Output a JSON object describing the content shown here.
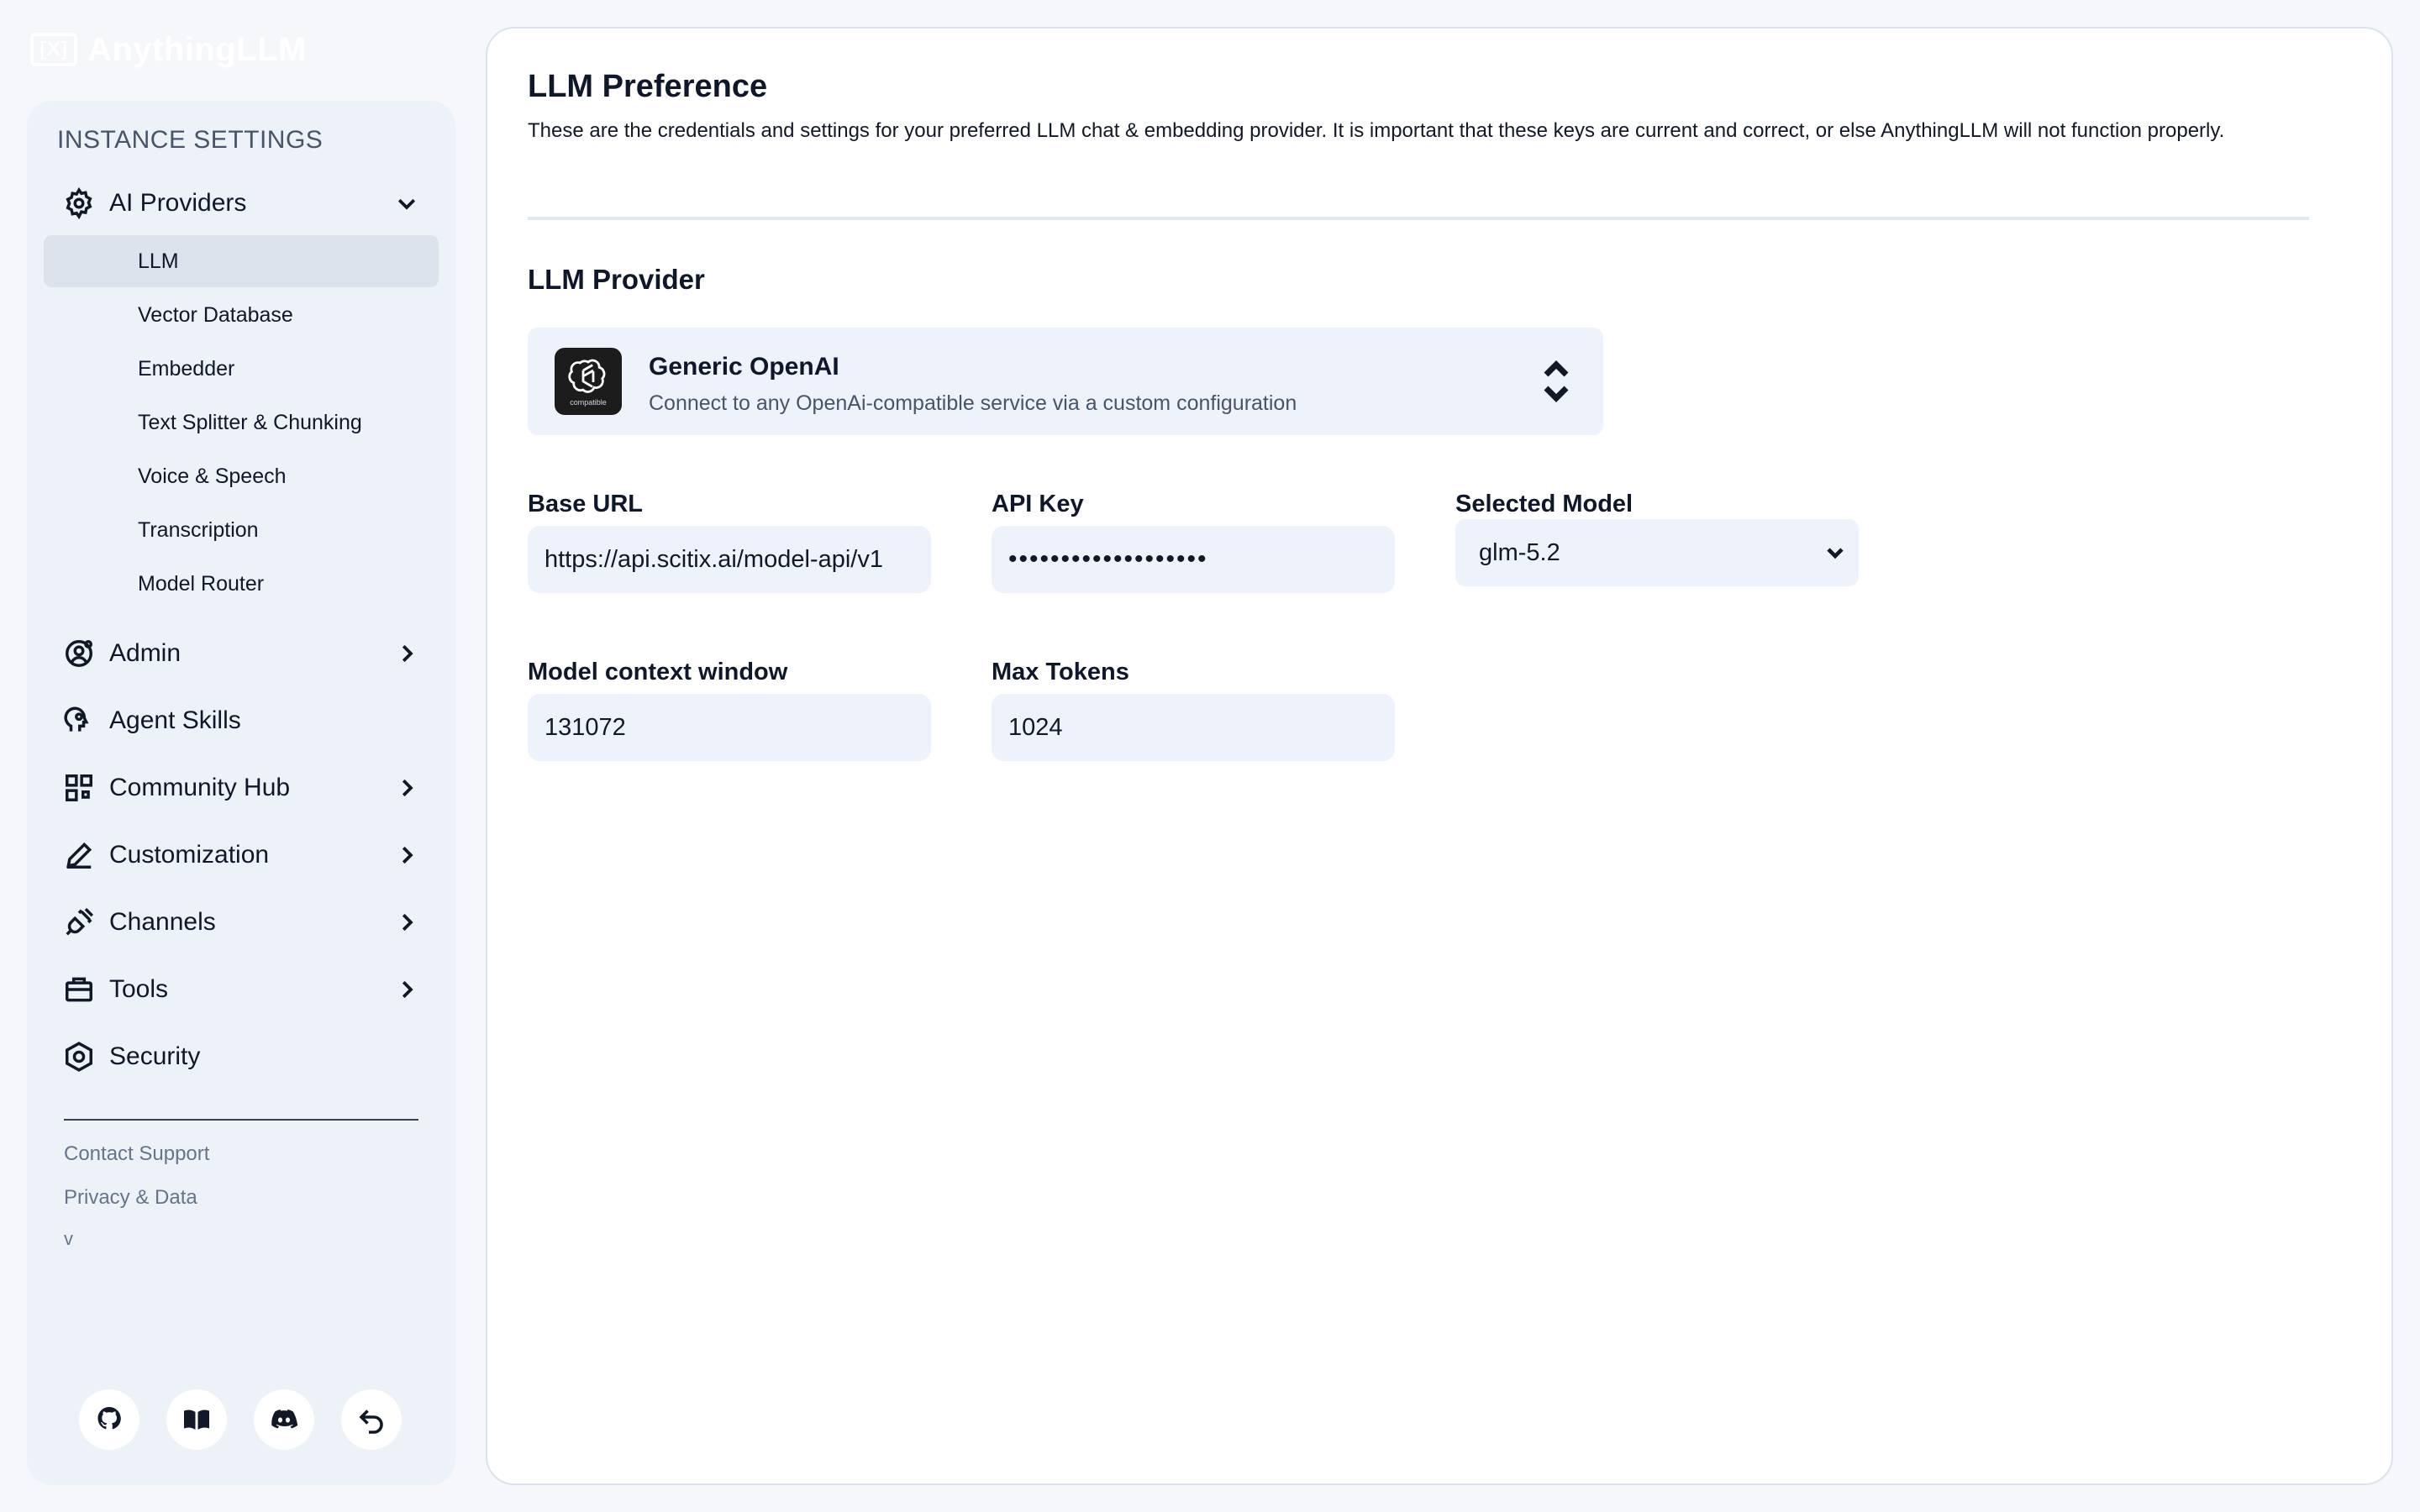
{
  "app": {
    "logo_text": "AnythingLLM",
    "logo_mark": "[X]"
  },
  "sidebar": {
    "header": "INSTANCE SETTINGS",
    "ai_providers": {
      "label": "AI Providers",
      "icon": "gear-icon",
      "expanded": true,
      "children": [
        {
          "label": "LLM",
          "active": true
        },
        {
          "label": "Vector Database",
          "active": false
        },
        {
          "label": "Embedder",
          "active": false
        },
        {
          "label": "Text Splitter & Chunking",
          "active": false
        },
        {
          "label": "Voice & Speech",
          "active": false
        },
        {
          "label": "Transcription",
          "active": false
        },
        {
          "label": "Model Router",
          "active": false
        }
      ]
    },
    "items": [
      {
        "label": "Admin",
        "icon": "user-gear-icon",
        "has_chevron": true
      },
      {
        "label": "Agent Skills",
        "icon": "brain-head-icon",
        "has_chevron": false
      },
      {
        "label": "Community Hub",
        "icon": "grid-squares-icon",
        "has_chevron": true
      },
      {
        "label": "Customization",
        "icon": "pencil-icon",
        "has_chevron": true
      },
      {
        "label": "Channels",
        "icon": "plug-icon",
        "has_chevron": true
      },
      {
        "label": "Tools",
        "icon": "toolbox-icon",
        "has_chevron": true
      },
      {
        "label": "Security",
        "icon": "shield-hexagon-icon",
        "has_chevron": false
      }
    ],
    "footer": {
      "contact_support": "Contact Support",
      "privacy_data": "Privacy & Data",
      "version": "v"
    },
    "bottom_icons": [
      "github-icon",
      "book-icon",
      "discord-icon",
      "undo-arrow-icon"
    ]
  },
  "main": {
    "title": "LLM Preference",
    "description": "These are the credentials and settings for your preferred LLM chat & embedding provider. It is important that these keys are current and correct, or else AnythingLLM will not function properly.",
    "provider_section_title": "LLM Provider",
    "provider": {
      "name": "Generic OpenAI",
      "description": "Connect to any OpenAi-compatible service via a custom configuration",
      "logo_caption": "compatible",
      "icon": "openai-logo-icon"
    },
    "fields": {
      "base_url": {
        "label": "Base URL",
        "value": "https://api.scitix.ai/model-api/v1"
      },
      "api_key": {
        "label": "API Key",
        "value": "•••••••••••••••••••"
      },
      "selected_model": {
        "label": "Selected Model",
        "value": "glm-5.2"
      },
      "context_window": {
        "label": "Model context window",
        "value": "131072"
      },
      "max_tokens": {
        "label": "Max Tokens",
        "value": "1024"
      }
    }
  },
  "colors": {
    "background": "#f5f7fa",
    "sidebar_bg": "#edf2f8",
    "active_item_bg": "#dde3ec",
    "input_bg": "#edf2fb",
    "text_primary": "#0f172a",
    "text_muted": "#64748b"
  }
}
